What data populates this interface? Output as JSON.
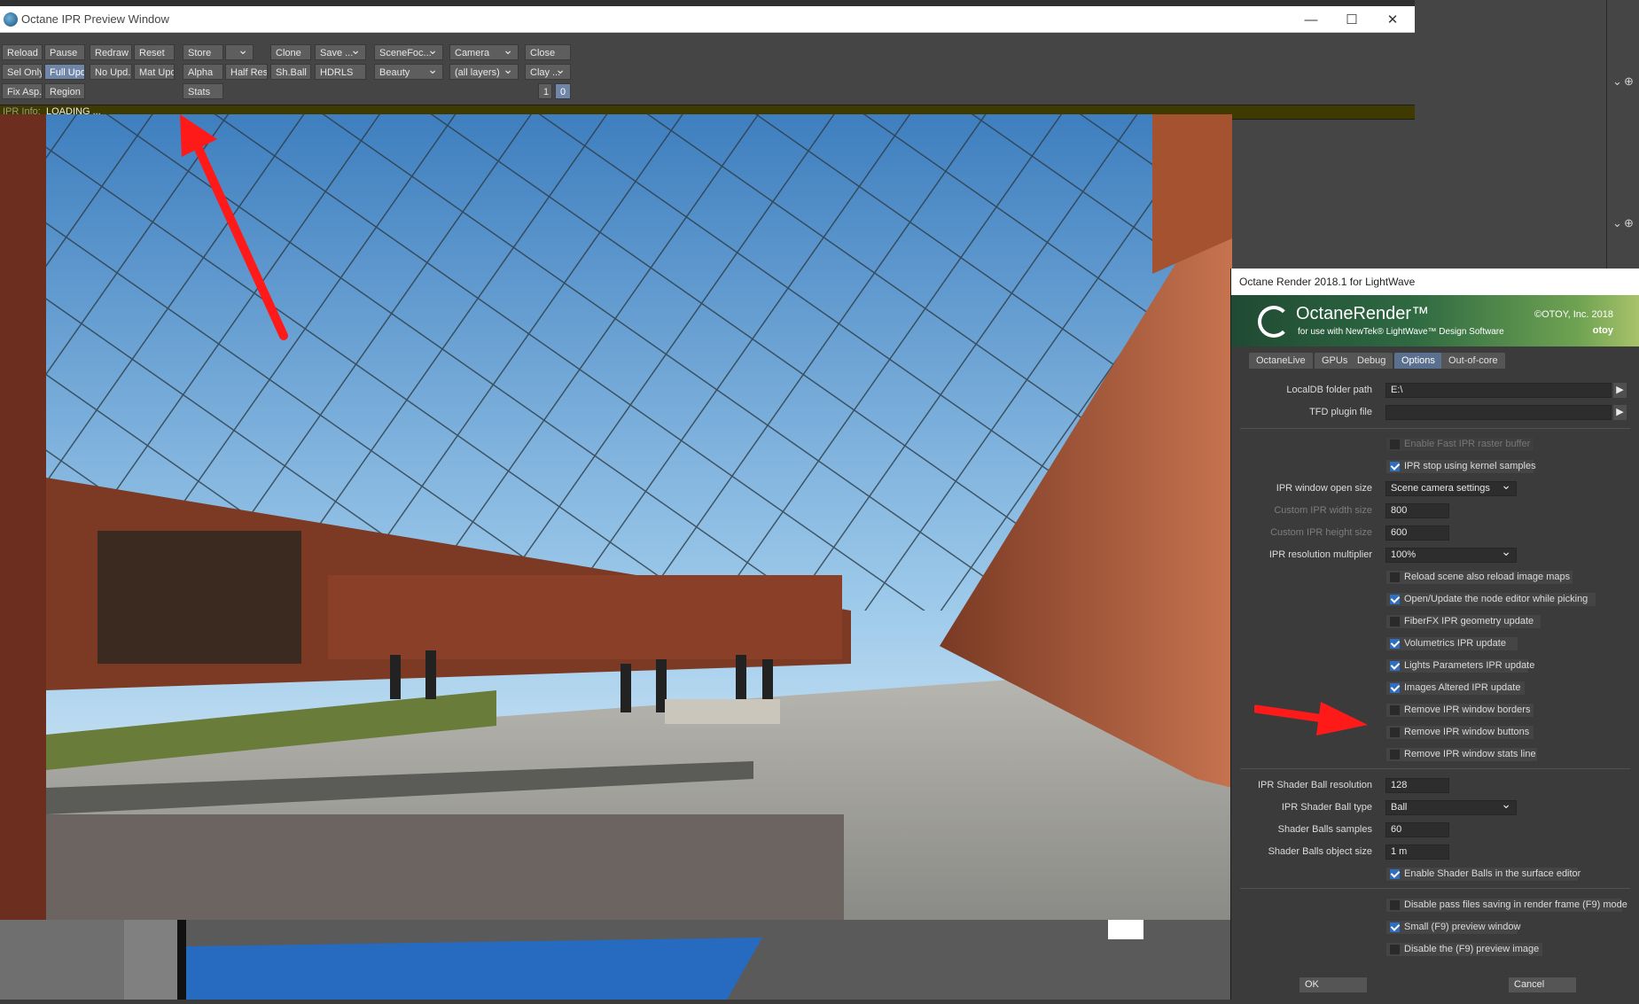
{
  "ipr_window": {
    "title": "Octane IPR Preview Window",
    "controls": {
      "minimize": "—",
      "maximize": "☐",
      "close": "✕"
    },
    "toolbar": {
      "row1": [
        "Reload",
        "Pause",
        "Redraw",
        "Reset",
        "Store",
        "",
        "Clone",
        "Save ...",
        "SceneFoc...",
        "Camera",
        "Close"
      ],
      "row2": [
        "Sel Only",
        "Full Upd.",
        "No Upd.",
        "Mat Upd",
        "Alpha",
        "Half Res",
        "Sh.Ball",
        "HDRLS",
        "Beauty",
        "(all layers)",
        "Clay ..."
      ],
      "row3": [
        "Fix Asp.",
        "Region",
        "Stats",
        "1",
        "0"
      ]
    },
    "status": {
      "label": "IPR Info:",
      "value": "LOADING ..."
    }
  },
  "octane_dialog": {
    "title": "Octane Render 2018.1 for LightWave",
    "banner": {
      "product": "OctaneRender™",
      "subtitle": "for use with NewTek® LightWave™ Design Software",
      "copyright": "©OTOY, Inc. 2018",
      "brand": "otoy"
    },
    "tabs": [
      "OctaneLive",
      "GPUs",
      "Debug",
      "Options",
      "Out-of-core"
    ],
    "active_tab": "Options",
    "fields": {
      "localdb_label": "LocalDB folder path",
      "localdb_value": "E:\\",
      "tfd_label": "TFD plugin file",
      "tfd_value": "",
      "ipr_open_size_label": "IPR window open size",
      "ipr_open_size_value": "Scene camera settings",
      "custom_width_label": "Custom IPR width size",
      "custom_width_value": "800",
      "custom_height_label": "Custom IPR height size",
      "custom_height_value": "600",
      "ipr_res_mult_label": "IPR resolution multiplier",
      "ipr_res_mult_value": "100%",
      "shader_ball_res_label": "IPR Shader Ball resolution",
      "shader_ball_res_value": "128",
      "shader_ball_type_label": "IPR Shader Ball type",
      "shader_ball_type_value": "Ball",
      "shader_balls_samples_label": "Shader Balls samples",
      "shader_balls_samples_value": "60",
      "shader_balls_size_label": "Shader Balls object size",
      "shader_balls_size_value": "1 m"
    },
    "checkboxes_a": [
      {
        "label": "Enable Fast IPR raster buffer",
        "checked": false,
        "disabled": true
      },
      {
        "label": "IPR stop using kernel samples",
        "checked": true,
        "disabled": false
      }
    ],
    "checkboxes_b": [
      {
        "label": "Reload scene also reload image maps",
        "checked": false
      },
      {
        "label": "Open/Update the node editor while picking",
        "checked": true
      },
      {
        "label": "FiberFX IPR geometry update",
        "checked": false
      },
      {
        "label": "Volumetrics IPR update",
        "checked": true
      },
      {
        "label": "Lights Parameters IPR update",
        "checked": true
      },
      {
        "label": "Images Altered IPR update",
        "checked": true
      },
      {
        "label": "Remove IPR window borders",
        "checked": false
      },
      {
        "label": "Remove IPR window buttons",
        "checked": false
      },
      {
        "label": "Remove IPR window stats line",
        "checked": false
      }
    ],
    "checkbox_shader": {
      "label": "Enable Shader Balls in the surface editor",
      "checked": true
    },
    "checkboxes_c": [
      {
        "label": "Disable pass files saving in render frame (F9) mode",
        "checked": false
      },
      {
        "label": "Small (F9) preview window",
        "checked": true
      },
      {
        "label": "Disable the (F9) preview image",
        "checked": false
      }
    ],
    "ok_label": "OK",
    "cancel_label": "Cancel"
  },
  "colors": {
    "accent": "#2f6fbf",
    "status_bar": "#3f3b00",
    "annotation_arrow": "#ff1a1a"
  }
}
